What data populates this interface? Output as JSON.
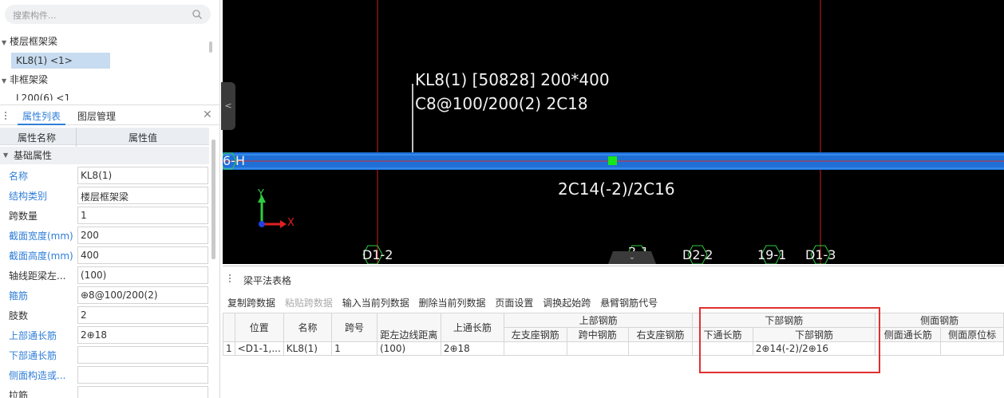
{
  "search": {
    "placeholder": "搜索构件..."
  },
  "tree": {
    "group1": "楼层框架梁",
    "selected_item": "KL8(1) <1>",
    "group2": "非框架梁",
    "partial_item": "L200(6) <1"
  },
  "panel_tabs": {
    "props": "属性列表",
    "layers": "图层管理"
  },
  "prop_header": {
    "name": "属性名称",
    "value": "属性值"
  },
  "prop_section": "基础属性",
  "props": [
    {
      "name": "名称",
      "value": "KL8(1)"
    },
    {
      "name": "结构类别",
      "value": "楼层框架梁"
    },
    {
      "name": "跨数量",
      "value": "1"
    },
    {
      "name": "截面宽度(mm)",
      "value": "200"
    },
    {
      "name": "截面高度(mm)",
      "value": "400"
    },
    {
      "name": "轴线距梁左...",
      "value": "(100)"
    },
    {
      "name": "箍筋",
      "value": "⊕8@100/200(2)"
    },
    {
      "name": "肢数",
      "value": "2"
    },
    {
      "name": "上部通长筋",
      "value": "2⊕18"
    },
    {
      "name": "下部通长筋",
      "value": ""
    },
    {
      "name": "侧面构造或...",
      "value": ""
    },
    {
      "name": "拉筋",
      "value": ""
    }
  ],
  "canvas": {
    "beam_label_line1": "KL8(1) [50828] 200*400",
    "beam_label_line2": "C8@100/200(2) 2C18",
    "bottom_rebar": "2C14(-2)/2C16",
    "axis_left": "6-H",
    "axis_y": "Y",
    "axis_x": "X",
    "grid_labels": [
      "D1-2",
      "2-1",
      "D2-2",
      "19-1",
      "D1-3"
    ]
  },
  "table_panel": {
    "title": "梁平法表格",
    "toolbar": [
      "复制跨数据",
      "粘贴跨数据",
      "输入当前列数据",
      "删除当前列数据",
      "页面设置",
      "调换起始跨",
      "悬臂钢筋代号"
    ],
    "headers": {
      "position": "位置",
      "name": "名称",
      "span": "跨号",
      "top_group": "上部钢筋",
      "bottom_group": "下部钢筋",
      "side_group": "侧面钢筋",
      "axis_dist": "距左边线距离",
      "top_through": "上通长筋",
      "left_support": "左支座钢筋",
      "mid_span": "跨中钢筋",
      "right_support": "右支座钢筋",
      "bottom_through": "下通长筋",
      "bottom_rebar": "下部钢筋",
      "side_through": "侧面通长筋",
      "side_original": "侧面原位标"
    },
    "row": {
      "num": "1",
      "position": "<D1-1,...",
      "name": "KL8(1)",
      "span": "1",
      "axis_dist": "(100)",
      "top_through": "2⊕18",
      "left_support": "",
      "mid_span": "",
      "right_support": "",
      "bottom_through": "",
      "bottom_rebar": "2⊕14(-2)/2⊕16",
      "side_through": "",
      "side_original": ""
    }
  }
}
